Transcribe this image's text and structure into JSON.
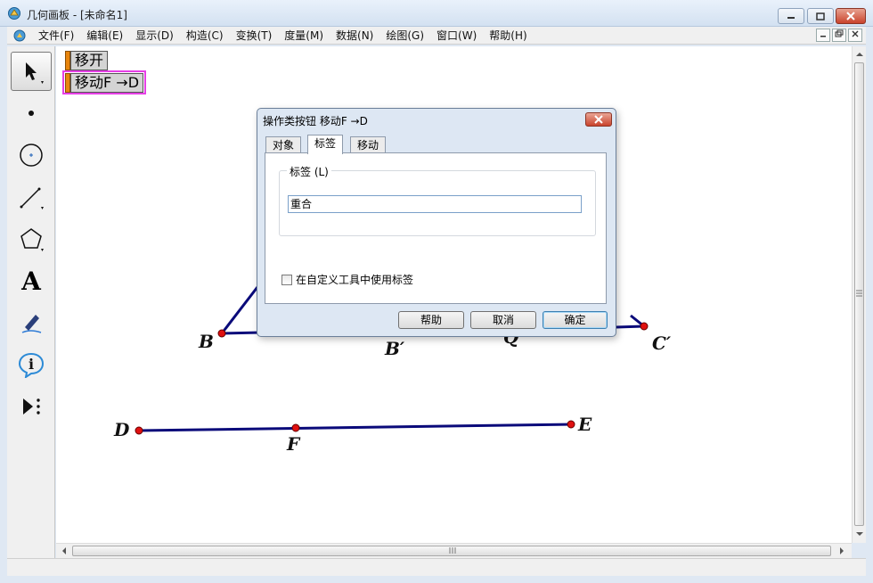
{
  "window": {
    "title": "几何画板 - [未命名1]"
  },
  "menu": [
    "文件(F)",
    "编辑(E)",
    "显示(D)",
    "构造(C)",
    "变换(T)",
    "度量(M)",
    "数据(N)",
    "绘图(G)",
    "窗口(W)",
    "帮助(H)"
  ],
  "toolbox": [
    {
      "name": "arrow-tool-icon",
      "selected": true
    },
    {
      "name": "point-tool-icon"
    },
    {
      "name": "compass-tool-icon"
    },
    {
      "name": "line-tool-icon"
    },
    {
      "name": "polygon-tool-icon"
    },
    {
      "name": "text-tool-icon",
      "glyph": "A"
    },
    {
      "name": "marker-tool-icon"
    },
    {
      "name": "information-tool-icon",
      "glyph": "i"
    },
    {
      "name": "custom-tool-icon"
    }
  ],
  "canvas": {
    "buttons": [
      {
        "label": "移开"
      },
      {
        "label": "移动F →D"
      }
    ],
    "points": [
      "B",
      "B′",
      "C′",
      "D",
      "E",
      "F"
    ],
    "colors": {
      "segment": "#0a0a7a",
      "point": "#e01010"
    }
  },
  "dialog": {
    "title": "操作类按钮 移动F →D",
    "tabs": [
      "对象",
      "标签",
      "移动"
    ],
    "active_tab": "标签",
    "group_label": "标签 (L)",
    "label_value": "重合",
    "checkbox_label": "在自定义工具中使用标签",
    "checkbox_checked": false,
    "buttons": {
      "help": "帮助",
      "cancel": "取消",
      "ok": "确定"
    }
  }
}
